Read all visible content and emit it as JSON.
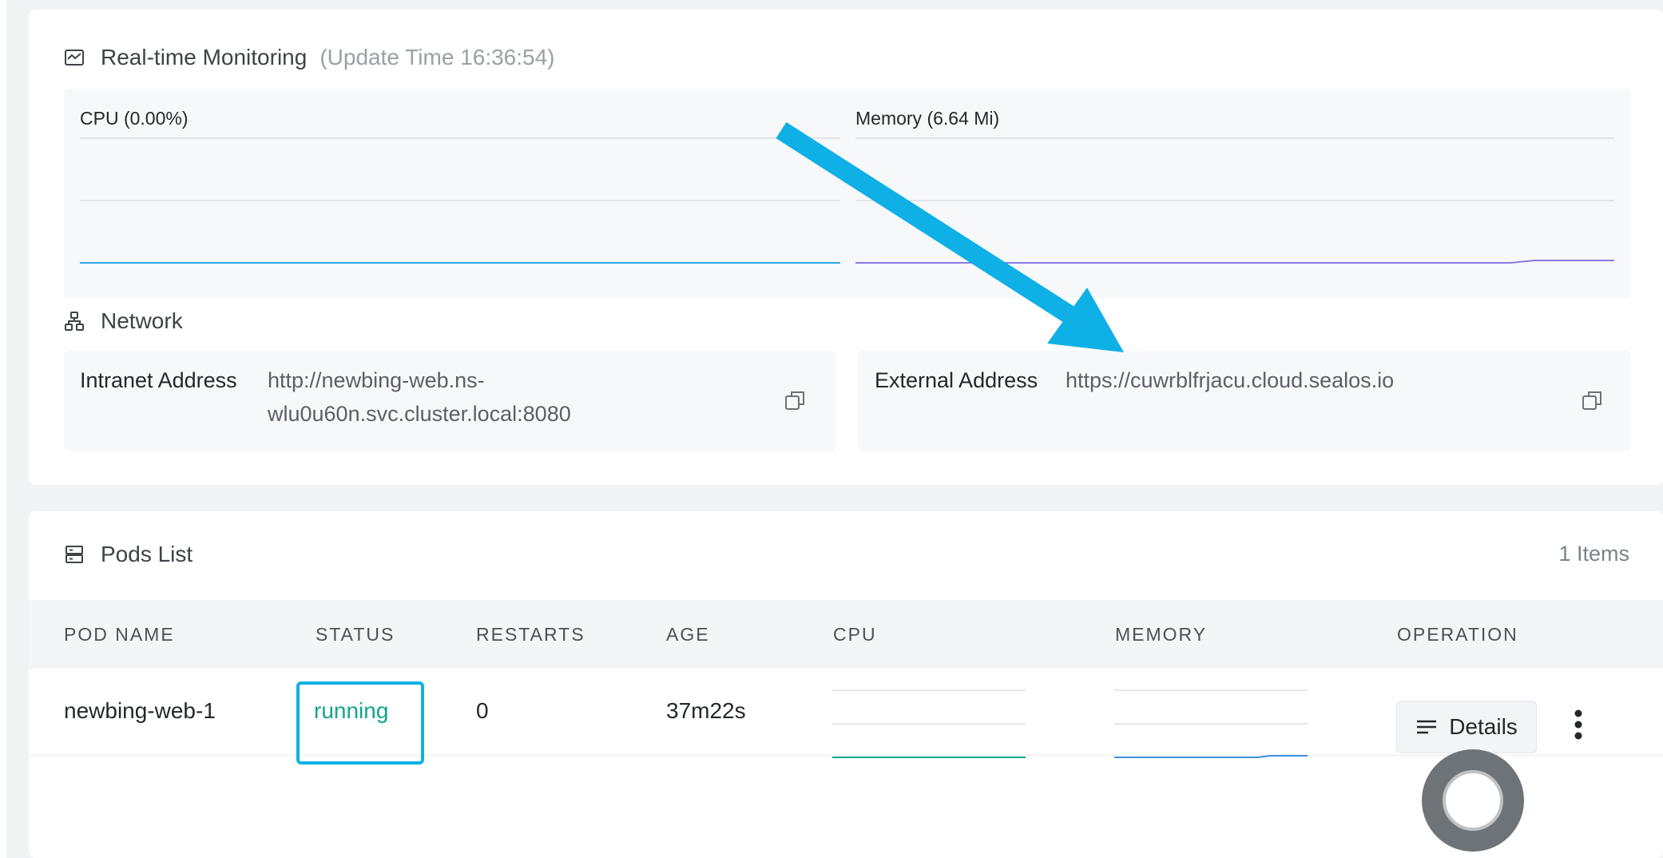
{
  "monitoring": {
    "title": "Real-time Monitoring",
    "update_time": "(Update Time  16:36:54)",
    "cpu_label": "CPU  (0.00%)",
    "memory_label": "Memory  (6.64 Mi)",
    "icon": "monitor-chart-icon"
  },
  "network": {
    "title": "Network",
    "icon": "network-topology-icon",
    "intranet_label": "Intranet Address",
    "intranet_value_line1": "http://newbing-web.ns-",
    "intranet_value_line2": "wlu0u60n.svc.cluster.local:8080",
    "external_label": "External Address",
    "external_value": "https://cuwrblfrjacu.cloud.sealos.io",
    "copy_icon": "copy-icon"
  },
  "pods": {
    "title": "Pods List",
    "icon": "server-list-icon",
    "count": "1 Items",
    "columns": [
      "POD NAME",
      "STATUS",
      "RESTARTS",
      "AGE",
      "CPU",
      "MEMORY",
      "OPERATION"
    ],
    "rows": [
      {
        "name": "newbing-web-1",
        "status": "running",
        "restarts": "0",
        "age": "37m22s",
        "details_label": "Details"
      }
    ]
  },
  "colors": {
    "accent": "#0eb0e6",
    "status_running": "#10a58c",
    "cpu_line": "#36a3e8",
    "memory_line": "#8a7be0",
    "pod_cpu_line": "#10a58c",
    "pod_memory_line": "#3b8fe0",
    "annotation_arrow": "#0eb0e6"
  }
}
